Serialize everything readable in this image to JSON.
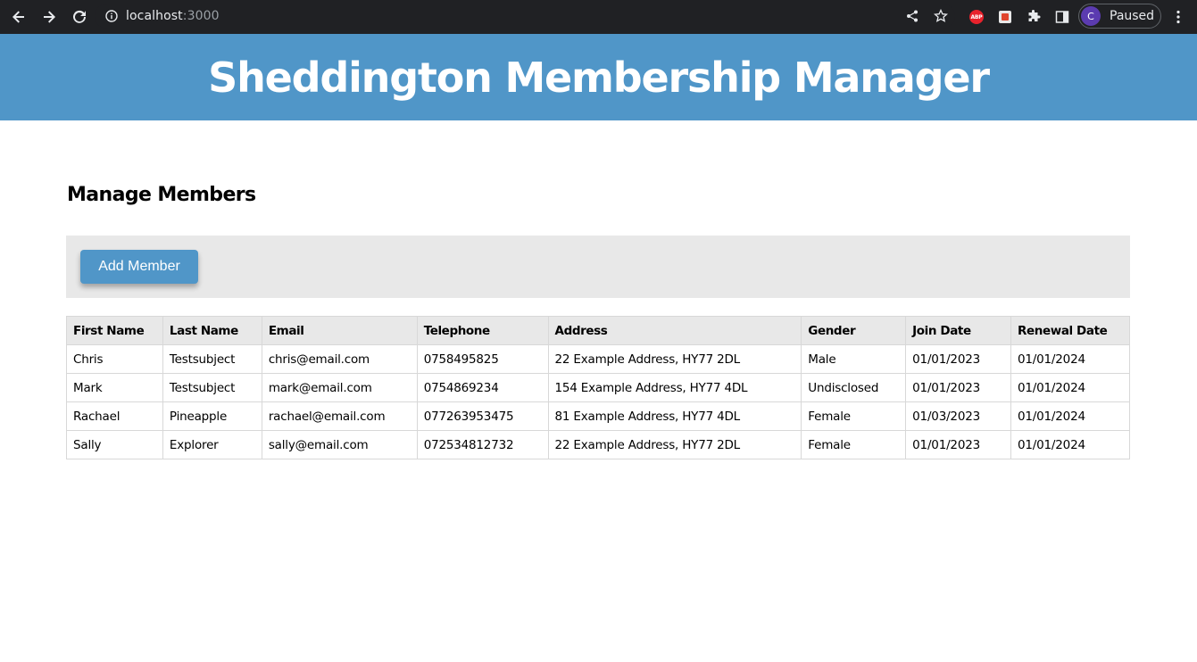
{
  "browser": {
    "url_host": "localhost",
    "url_port": ":3000",
    "profile_initial": "C",
    "profile_status": "Paused",
    "extension_abp": "ABP"
  },
  "header": {
    "title": "Sheddington Membership Manager",
    "background_color": "#5096c8"
  },
  "main": {
    "section_title": "Manage Members",
    "add_button_label": "Add Member"
  },
  "table": {
    "columns": [
      "First Name",
      "Last Name",
      "Email",
      "Telephone",
      "Address",
      "Gender",
      "Join Date",
      "Renewal Date"
    ],
    "rows": [
      [
        "Chris",
        "Testsubject",
        "chris@email.com",
        "0758495825",
        "22 Example Address, HY77 2DL",
        "Male",
        "01/01/2023",
        "01/01/2024"
      ],
      [
        "Mark",
        "Testsubject",
        "mark@email.com",
        "0754869234",
        "154 Example Address, HY77 4DL",
        "Undisclosed",
        "01/01/2023",
        "01/01/2024"
      ],
      [
        "Rachael",
        "Pineapple",
        "rachael@email.com",
        "077263953475",
        "81 Example Address, HY77 4DL",
        "Female",
        "01/03/2023",
        "01/01/2024"
      ],
      [
        "Sally",
        "Explorer",
        "sally@email.com",
        "072534812732",
        "22 Example Address, HY77 2DL",
        "Female",
        "01/01/2023",
        "01/01/2024"
      ]
    ]
  }
}
